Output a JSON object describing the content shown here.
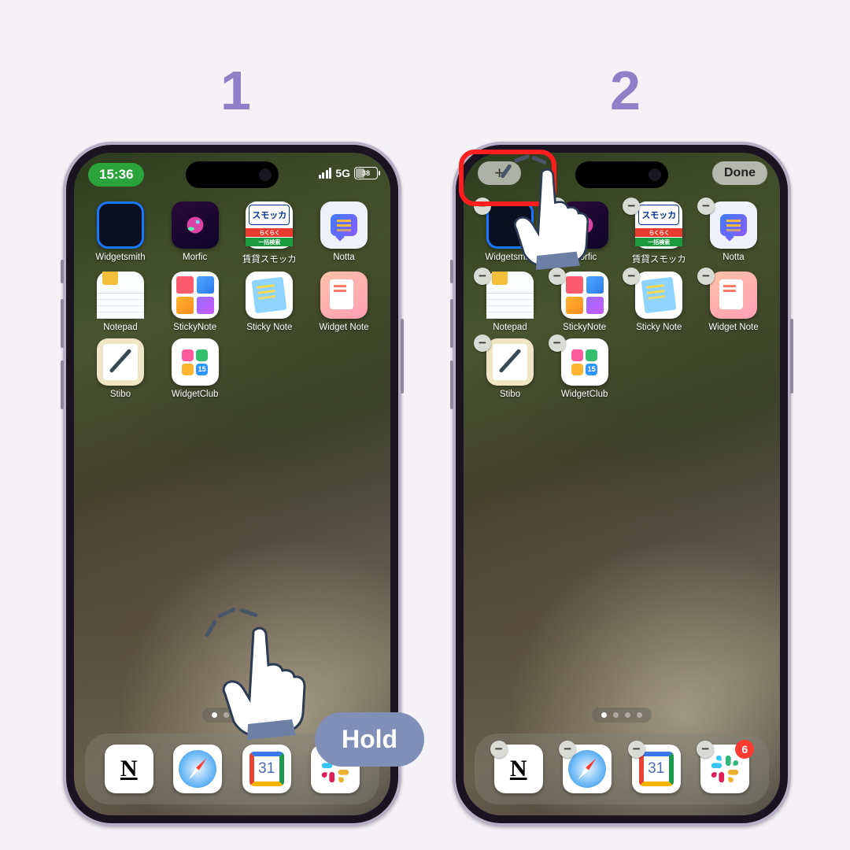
{
  "steps": {
    "s1": "1",
    "s2": "2"
  },
  "status": {
    "time": "15:36",
    "net": "5G",
    "battery": "38"
  },
  "apps": {
    "r1": [
      {
        "label": "Widgetsmith",
        "tile": "t-widgetsmith",
        "name": "app-widgetsmith"
      },
      {
        "label": "Morfic",
        "tile": "t-morfic",
        "name": "app-morfic"
      },
      {
        "label": "賃貸スモッカ",
        "tile": "t-smocca",
        "name": "app-smocca"
      },
      {
        "label": "Notta",
        "tile": "t-notta",
        "name": "app-notta"
      }
    ],
    "r2": [
      {
        "label": "Notepad",
        "tile": "t-notepad",
        "name": "app-notepad"
      },
      {
        "label": "StickyNote",
        "tile": "t-sticky1",
        "name": "app-stickynote"
      },
      {
        "label": "Sticky Note",
        "tile": "t-sticky2",
        "name": "app-sticky-note"
      },
      {
        "label": "Widget Note",
        "tile": "t-widgetnote",
        "name": "app-widget-note"
      }
    ],
    "r3": [
      {
        "label": "Stibo",
        "tile": "t-stibo",
        "name": "app-stibo"
      },
      {
        "label": "WidgetClub",
        "tile": "t-widgetclub",
        "name": "app-widgetclub"
      }
    ]
  },
  "smocca": {
    "logo": "スモッカ",
    "band": "らくらく",
    "sub": "一括検索"
  },
  "dock": {
    "notion": "N",
    "calDay": "31",
    "slackBadge": "6"
  },
  "wcDay": "15",
  "phone2": {
    "plus": "+",
    "done": "Done"
  },
  "hold": "Hold"
}
